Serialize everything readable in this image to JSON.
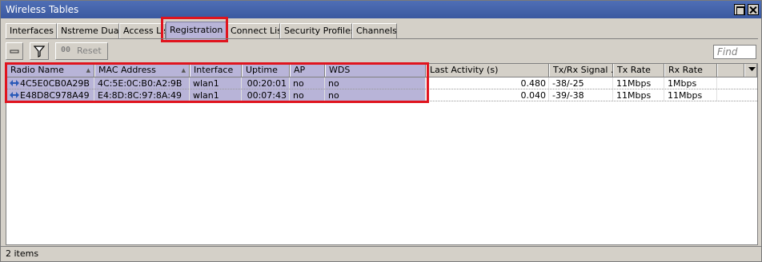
{
  "window": {
    "title": "Wireless Tables"
  },
  "tabs": [
    {
      "label": "Interfaces"
    },
    {
      "label": "Nstreme Dual"
    },
    {
      "label": "Access List"
    },
    {
      "label": "Registration"
    },
    {
      "label": "Connect List"
    },
    {
      "label": "Security Profiles"
    },
    {
      "label": "Channels"
    }
  ],
  "toolbar": {
    "reset_icon_text": "00",
    "reset_label": "Reset",
    "find_placeholder": "Find"
  },
  "table": {
    "columns": [
      {
        "label": "Radio Name"
      },
      {
        "label": "MAC Address"
      },
      {
        "label": "Interface"
      },
      {
        "label": "Uptime"
      },
      {
        "label": "AP"
      },
      {
        "label": "WDS"
      },
      {
        "label": "Last Activity (s)"
      },
      {
        "label": "Tx/Rx Signal ..."
      },
      {
        "label": "Tx Rate"
      },
      {
        "label": "Rx Rate"
      }
    ],
    "rows": [
      [
        "4C5E0CB0A29B",
        "4C:5E:0C:B0:A2:9B",
        "wlan1",
        "00:20:01",
        "no",
        "no",
        "0.480",
        "-38/-25",
        "11Mbps",
        "1Mbps"
      ],
      [
        "E48D8C978A49",
        "E4:8D:8C:97:8A:49",
        "wlan1",
        "00:07:43",
        "no",
        "no",
        "0.040",
        "-39/-38",
        "11Mbps",
        "11Mbps"
      ]
    ]
  },
  "status": {
    "items_text": "2 items"
  },
  "colors": {
    "highlight": "#e0141e",
    "selection": "#b8b4d8",
    "titlebar": "#3f5fa8"
  }
}
